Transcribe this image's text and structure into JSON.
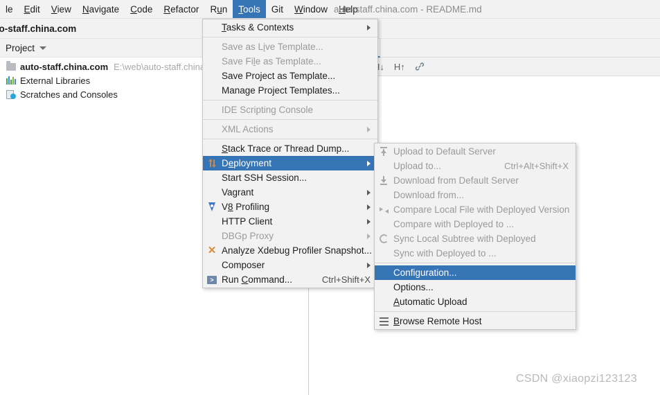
{
  "window": {
    "title": "auto-staff.china.com - README.md"
  },
  "menubar": {
    "items": [
      {
        "label": "le",
        "mnemonic": "",
        "selected": false
      },
      {
        "label": "Edit",
        "mnemonic": "E",
        "selected": false
      },
      {
        "label": "View",
        "mnemonic": "V",
        "selected": false
      },
      {
        "label": "Navigate",
        "mnemonic": "N",
        "selected": false
      },
      {
        "label": "Code",
        "mnemonic": "C",
        "selected": false
      },
      {
        "label": "Refactor",
        "mnemonic": "R",
        "selected": false
      },
      {
        "label": "Run",
        "mnemonic": "u",
        "selected": false
      },
      {
        "label": "Tools",
        "mnemonic": "T",
        "selected": true
      },
      {
        "label": "Git",
        "mnemonic": "",
        "selected": false
      },
      {
        "label": "Window",
        "mnemonic": "W",
        "selected": false
      },
      {
        "label": "Help",
        "mnemonic": "H",
        "selected": false
      }
    ]
  },
  "navstrip": {
    "breadcrumb": "to-staff.china.com"
  },
  "project_panel": {
    "toolbar_label": "Project",
    "tree": [
      {
        "label": "auto-staff.china.com",
        "path": "E:\\web\\auto-staff.china.c",
        "icon": "folder-icon",
        "bold": true
      },
      {
        "label": "External Libraries",
        "path": "",
        "icon": "libraries-icon",
        "bold": false
      },
      {
        "label": "Scratches and Consoles",
        "path": "",
        "icon": "scratches-icon",
        "bold": false
      }
    ]
  },
  "editor": {
    "tab_close_glyph": "×",
    "toolbar_buttons": [
      {
        "label": "H↓",
        "name": "heading-down-icon"
      },
      {
        "label": "H↑",
        "name": "heading-up-icon"
      },
      {
        "label": "🔗",
        "name": "link-icon"
      }
    ]
  },
  "tools_menu": {
    "items": [
      {
        "label": "Tasks & Contexts",
        "mnemonic": "T",
        "disabled": false,
        "submenu": true,
        "accel": "",
        "icon": ""
      },
      {
        "separator": true
      },
      {
        "label": "Save as Live Template...",
        "mnemonic": "i",
        "disabled": true,
        "submenu": false,
        "accel": "",
        "icon": ""
      },
      {
        "label": "Save File as Template...",
        "mnemonic": "l",
        "disabled": true,
        "submenu": false,
        "accel": "",
        "icon": ""
      },
      {
        "label": "Save Project as Template...",
        "mnemonic": "",
        "disabled": false,
        "submenu": false,
        "accel": "",
        "icon": ""
      },
      {
        "label": "Manage Project Templates...",
        "mnemonic": "",
        "disabled": false,
        "submenu": false,
        "accel": "",
        "icon": ""
      },
      {
        "separator": true
      },
      {
        "label": "IDE Scripting Console",
        "mnemonic": "",
        "disabled": true,
        "submenu": false,
        "accel": "",
        "icon": ""
      },
      {
        "separator": true
      },
      {
        "label": "XML Actions",
        "mnemonic": "",
        "disabled": true,
        "submenu": true,
        "accel": "",
        "icon": ""
      },
      {
        "separator": true
      },
      {
        "label": "Stack Trace or Thread Dump...",
        "mnemonic": "S",
        "disabled": false,
        "submenu": false,
        "accel": "",
        "icon": ""
      },
      {
        "label": "Deployment",
        "mnemonic": "e",
        "disabled": false,
        "submenu": true,
        "accel": "",
        "icon": "deployment-icon",
        "highlight": true
      },
      {
        "label": "Start SSH Session...",
        "mnemonic": "",
        "disabled": false,
        "submenu": false,
        "accel": "",
        "icon": ""
      },
      {
        "label": "Vagrant",
        "mnemonic": "",
        "disabled": false,
        "submenu": true,
        "accel": "",
        "icon": ""
      },
      {
        "label": "V8 Profiling",
        "mnemonic": "8",
        "disabled": false,
        "submenu": true,
        "accel": "",
        "icon": "v8-icon"
      },
      {
        "label": "HTTP Client",
        "mnemonic": "",
        "disabled": false,
        "submenu": true,
        "accel": "",
        "icon": ""
      },
      {
        "label": "DBGp Proxy",
        "mnemonic": "",
        "disabled": true,
        "submenu": true,
        "accel": "",
        "icon": ""
      },
      {
        "label": "Analyze Xdebug Profiler Snapshot...",
        "mnemonic": "",
        "disabled": false,
        "submenu": false,
        "accel": "",
        "icon": "xdebug-icon"
      },
      {
        "label": "Composer",
        "mnemonic": "",
        "disabled": false,
        "submenu": true,
        "accel": "",
        "icon": ""
      },
      {
        "label": "Run Command...",
        "mnemonic": "C",
        "disabled": false,
        "submenu": false,
        "accel": "Ctrl+Shift+X",
        "icon": "console-icon"
      }
    ]
  },
  "deployment_submenu": {
    "items": [
      {
        "label": "Upload to Default Server",
        "disabled": true,
        "accel": "",
        "icon": "upload-icon"
      },
      {
        "label": "Upload to...",
        "disabled": true,
        "accel": "Ctrl+Alt+Shift+X",
        "icon": ""
      },
      {
        "label": "Download from Default Server",
        "disabled": true,
        "accel": "",
        "icon": "download-icon"
      },
      {
        "label": "Download from...",
        "disabled": true,
        "accel": "",
        "icon": ""
      },
      {
        "label": "Compare Local File with Deployed Version",
        "disabled": true,
        "accel": "",
        "icon": "compare-icon"
      },
      {
        "label": "Compare with Deployed to ...",
        "disabled": true,
        "accel": "",
        "icon": ""
      },
      {
        "label": "Sync Local Subtree with Deployed",
        "disabled": true,
        "accel": "",
        "icon": "sync-icon"
      },
      {
        "label": "Sync with Deployed to ...",
        "disabled": true,
        "accel": "",
        "icon": ""
      },
      {
        "separator": true
      },
      {
        "label": "Configuration...",
        "disabled": false,
        "accel": "",
        "icon": "",
        "highlight": true
      },
      {
        "label": "Options...",
        "disabled": false,
        "accel": "",
        "icon": ""
      },
      {
        "label": "Automatic Upload",
        "mnemonic": "A",
        "disabled": false,
        "accel": "",
        "icon": ""
      },
      {
        "separator": true
      },
      {
        "label": "Browse Remote Host",
        "mnemonic": "B",
        "disabled": false,
        "accel": "",
        "icon": "browse-icon"
      }
    ]
  },
  "watermark": {
    "text": "CSDN @xiaopzi123123"
  }
}
